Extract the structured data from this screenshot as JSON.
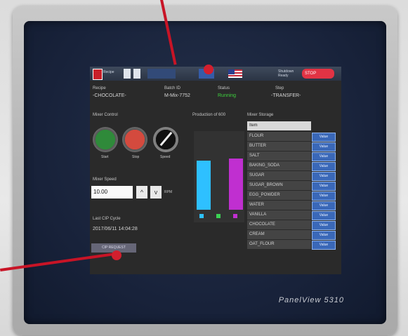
{
  "device": {
    "bezel_logo": "",
    "model": "PanelView 5310"
  },
  "hmi": {
    "header": {
      "title_left": "Recipe",
      "top_labels": [
        "",
        "",
        "",
        ""
      ],
      "right_label": "Shutdown Ready",
      "stop_label": "STOP"
    },
    "info": {
      "recipe_label": "Recipe",
      "recipe_value": "-CHOCOLATE-",
      "batch_label": "Batch ID",
      "batch_value": "M-Mix-7752",
      "status_label": "Status",
      "status_value": "Running",
      "step_label": "Step",
      "step_value": "-TRANSFER-"
    },
    "mixer_control": {
      "title": "Mixer Control",
      "start": "Start",
      "stop": "Stop",
      "speed": "Speed"
    },
    "production": {
      "title": "Production of 600",
      "bar_values": [
        70,
        73
      ]
    },
    "mixer_speed": {
      "title": "Mixer Speed",
      "value": "10.00",
      "unit": "RPM"
    },
    "last_cip": {
      "title": "Last CIP Cycle",
      "value": "2017/06/11 14:04:28"
    },
    "button_primary": "CIP REQUEST",
    "ingredients": {
      "title": "Mixer Storage",
      "header": "Item",
      "items": [
        "FLOUR",
        "BUTTER",
        "SALT",
        "BAKING_SODA",
        "SUGAR",
        "SUGAR_BROWN",
        "EGG_POWDER",
        "WATER",
        "VANILLA",
        "CHOCOLATE",
        "CREAM",
        "OAT_FLOUR"
      ],
      "button_label": "Value"
    }
  }
}
